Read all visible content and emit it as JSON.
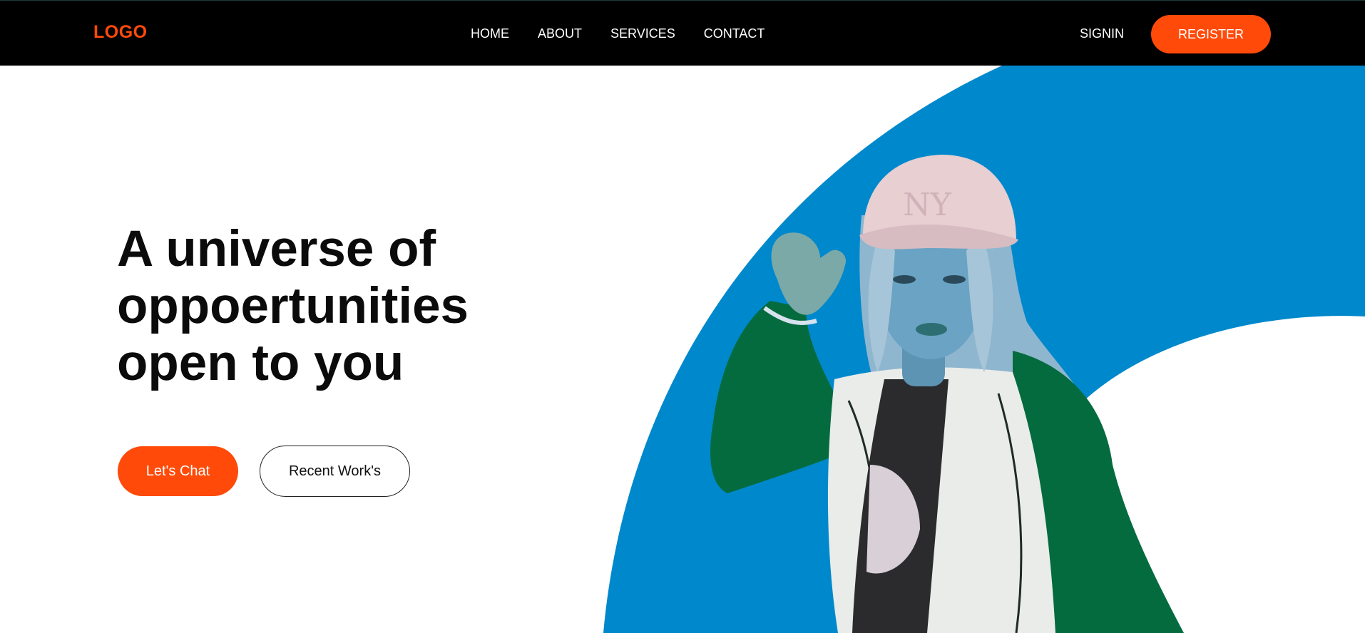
{
  "header": {
    "logo": "LOGO",
    "nav": [
      "HOME",
      "ABOUT",
      "SERVICES",
      "CONTACT"
    ],
    "signin": "SIGNIN",
    "register": "REGISTER"
  },
  "hero": {
    "title_lines": [
      "A universe of",
      "oppoertunities",
      "open to you"
    ],
    "primary_button": "Let's Chat",
    "secondary_button": "Recent Work's"
  },
  "colors": {
    "accent": "#ff4a0a",
    "blue_shape": "#0088cc",
    "header_bg": "#000000"
  }
}
